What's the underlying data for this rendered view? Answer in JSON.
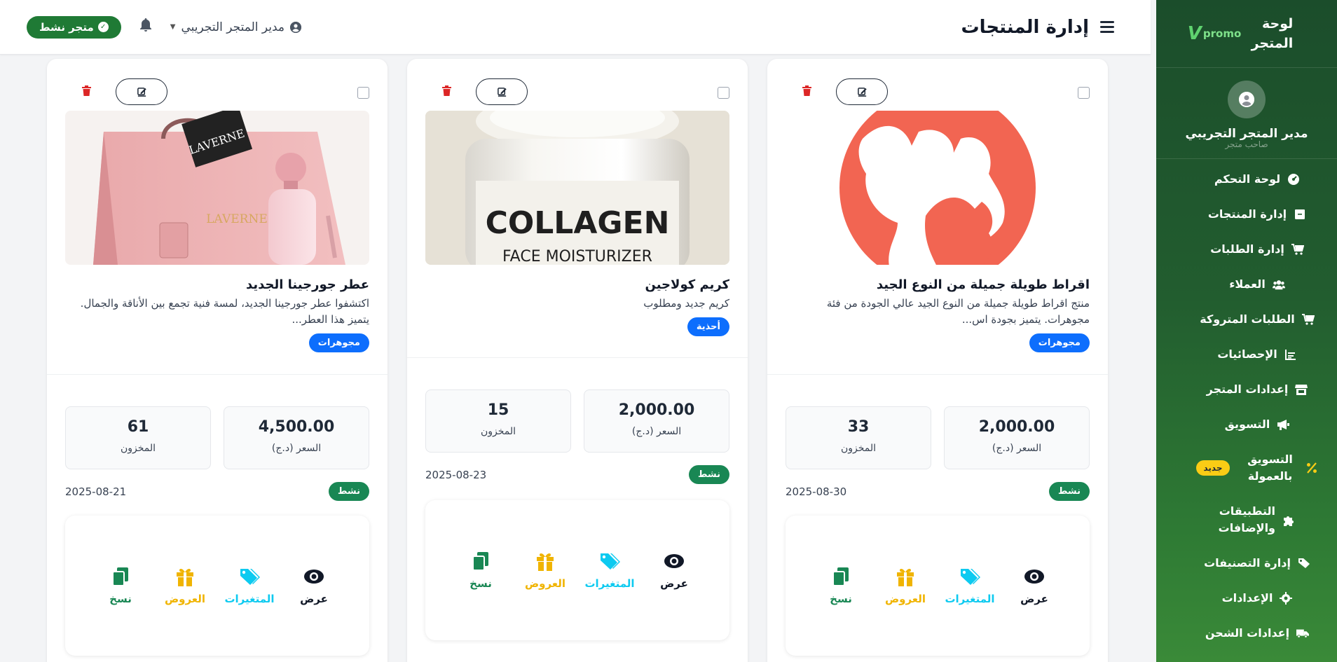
{
  "sidebar": {
    "brand_title": "لوحة المتجر",
    "logo_text": "promo",
    "logo_mark": "V",
    "profile_name": "مدير المتجر التجريبي",
    "profile_role": "صاحب متجر",
    "new_badge": "جديد",
    "items": [
      {
        "label": "لوحة التحكم",
        "icon": "dashboard-icon"
      },
      {
        "label": "إدارة المنتجات",
        "icon": "box-icon"
      },
      {
        "label": "إدارة الطلبات",
        "icon": "cart-icon"
      },
      {
        "label": "العملاء",
        "icon": "users-icon"
      },
      {
        "label": "الطلبات المتروكة",
        "icon": "cart-icon"
      },
      {
        "label": "الإحصائيات",
        "icon": "chart-icon"
      },
      {
        "label": "إعدادات المتجر",
        "icon": "store-icon"
      },
      {
        "label": "التسويق",
        "icon": "megaphone-icon"
      },
      {
        "label": "التسويق بالعمولة",
        "icon": "percent-icon"
      },
      {
        "label": "التطبيقات والإضافات",
        "icon": "puzzle-icon"
      },
      {
        "label": "إدارة التصنيفات",
        "icon": "tags-icon"
      },
      {
        "label": "الإعدادات",
        "icon": "gear-icon"
      },
      {
        "label": "إعدادات الشحن",
        "icon": "truck-icon"
      }
    ]
  },
  "header": {
    "title": "إدارة المنتجات",
    "store_status": "متجر نشط",
    "user_name": "مدير المتجر التجريبي"
  },
  "labels": {
    "price": "السعر (د.ج)",
    "stock": "المخزون",
    "view": "عرض",
    "variants": "المتغيرات",
    "offers": "العروض",
    "copy": "نسخ"
  },
  "products": [
    {
      "title": "اقراط طويلة جميلة من النوع الجيد",
      "description": "منتج اقراط طويلة جميلة من النوع الجيد عالي الجودة من فئة مجوهرات. يتميز بجودة اس...",
      "category": "مجوهرات",
      "price": "2,000.00",
      "stock": "33",
      "status": "نشط",
      "date": "2025-08-30"
    },
    {
      "title": "كريم كولاجين",
      "description": "كريم جديد ومطلوب",
      "category": "أحذية",
      "price": "2,000.00",
      "stock": "15",
      "status": "نشط",
      "date": "2025-08-23",
      "image_text_1": "COLLAGEN",
      "image_text_2": "FACE MOISTURIZER"
    },
    {
      "title": "عطر جورجينا الجديد",
      "description": "اكتشفوا عطر جورجينا الجديد، لمسة فنية تجمع بين الأناقة والجمال. يتميز هذا العطر...",
      "category": "مجوهرات",
      "price": "4,500.00",
      "stock": "61",
      "status": "نشط",
      "date": "2025-08-21",
      "image_text_1": "LAVERNE",
      "image_text_2": "LAVERNE"
    }
  ],
  "colors": {
    "primary_green": "#1f7a35",
    "badge_blue": "#0d6efd",
    "status_green": "#198754",
    "delete_red": "#dc2626",
    "variants_cyan": "#0dcaf0",
    "offers_yellow": "#f0b400"
  }
}
